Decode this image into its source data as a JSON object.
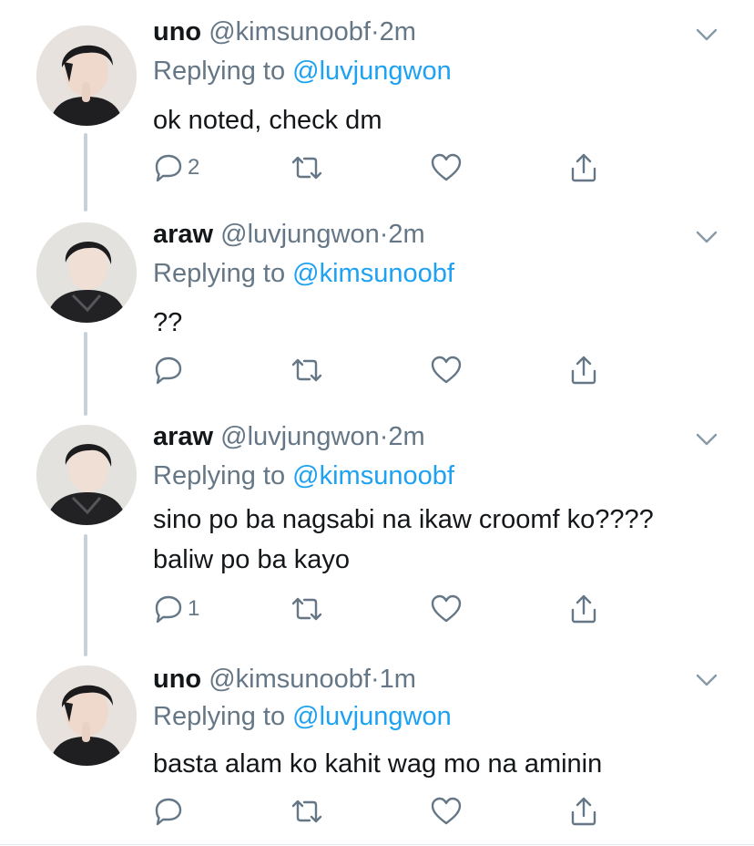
{
  "tweets": [
    {
      "name": "uno",
      "handle": "@kimsunoobf",
      "separator": "·",
      "time": "2m",
      "replying_prefix": "Replying to",
      "replying_to": "@luvjungwon",
      "lines": [
        "ok noted, check dm"
      ],
      "reply_count": "2"
    },
    {
      "name": "araw",
      "handle": "@luvjungwon",
      "separator": "·",
      "time": "2m",
      "replying_prefix": "Replying to",
      "replying_to": "@kimsunoobf",
      "lines": [
        "??"
      ],
      "reply_count": ""
    },
    {
      "name": "araw",
      "handle": "@luvjungwon",
      "separator": "·",
      "time": "2m",
      "replying_prefix": "Replying to",
      "replying_to": "@kimsunoobf",
      "lines": [
        "sino po ba nagsabi na ikaw croomf ko????",
        "baliw po ba kayo"
      ],
      "reply_count": "1"
    },
    {
      "name": "uno",
      "handle": "@kimsunoobf",
      "separator": "·",
      "time": "1m",
      "replying_prefix": "Replying to",
      "replying_to": "@luvjungwon",
      "lines": [
        "basta alam ko kahit wag mo na aminin"
      ],
      "reply_count": ""
    }
  ],
  "colors": {
    "text": "#14171a",
    "muted": "#657786",
    "link": "#1da1f2",
    "thread_line": "#c9d1d8"
  },
  "icons": [
    "reply-icon",
    "retweet-icon",
    "like-icon",
    "share-icon",
    "chevron-down-icon"
  ]
}
